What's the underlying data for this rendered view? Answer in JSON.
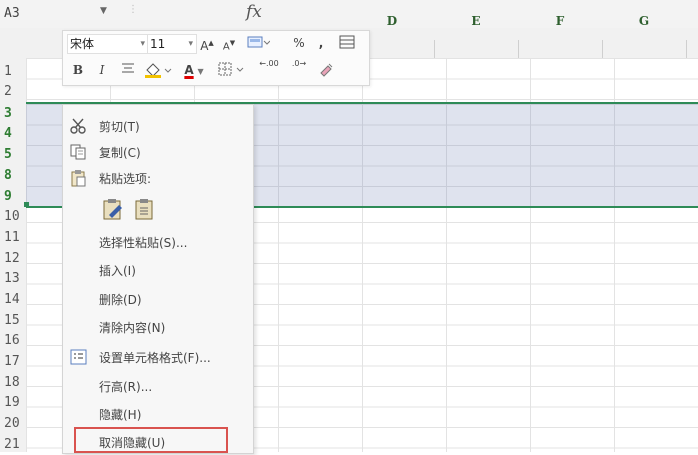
{
  "formula_bar": {
    "name_box": "A3",
    "fx": "fx"
  },
  "columns": [
    "D",
    "E",
    "F",
    "G"
  ],
  "rows": [
    "1",
    "2",
    "3",
    "4",
    "5",
    "8",
    "9",
    "10",
    "11",
    "12",
    "13",
    "14",
    "15",
    "16",
    "17",
    "18",
    "19",
    "20",
    "21"
  ],
  "mini_toolbar": {
    "font_name": "宋体",
    "font_size": "11",
    "grow_font": "A",
    "shrink_font": "A",
    "percent": "%",
    "comma": ",",
    "bold": "B",
    "italic": "I",
    "font_color_label": "A",
    "dec_increase": ".00",
    "dec_decrease": ".0"
  },
  "context_menu": {
    "cut": "剪切(T)",
    "copy": "复制(C)",
    "paste_options": "粘贴选项:",
    "paste_special": "选择性粘贴(S)...",
    "insert": "插入(I)",
    "delete": "删除(D)",
    "clear_contents": "清除内容(N)",
    "format_cells": "设置单元格格式(F)...",
    "row_height": "行高(R)...",
    "hide": "隐藏(H)",
    "unhide": "取消隐藏(U)"
  },
  "colors": {
    "selection_border": "#2e8b57",
    "highlight": "#d9534f",
    "selection_fill": "#dfe3ee"
  }
}
